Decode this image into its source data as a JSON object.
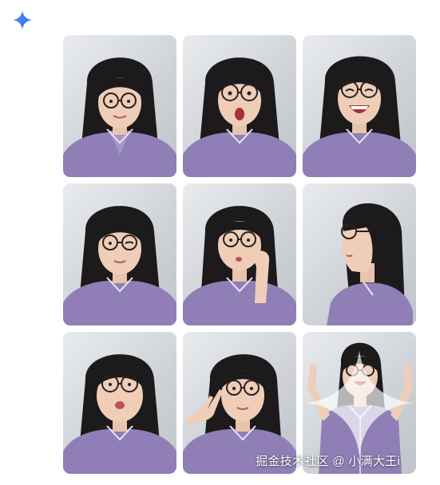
{
  "header": {
    "spark_icon": "gemini-sparkle-icon",
    "accent_color": "#4285f4"
  },
  "photos": [
    {
      "label": "glasses-smile",
      "expression": "smile"
    },
    {
      "label": "glasses-surprised",
      "expression": "surprised"
    },
    {
      "label": "glasses-laughing",
      "expression": "laugh"
    },
    {
      "label": "glasses-wink",
      "expression": "wink"
    },
    {
      "label": "chin-on-hand",
      "expression": "pout"
    },
    {
      "label": "side-profile",
      "expression": "profile"
    },
    {
      "label": "kissy-face",
      "expression": "kiss"
    },
    {
      "label": "peace-sign",
      "expression": "peace"
    },
    {
      "label": "arms-raised-cheering",
      "expression": "cheer"
    }
  ],
  "shirt_color": "#8f7fb6",
  "watermark": {
    "text": "掘金技术社区 @ 小满大王i"
  }
}
